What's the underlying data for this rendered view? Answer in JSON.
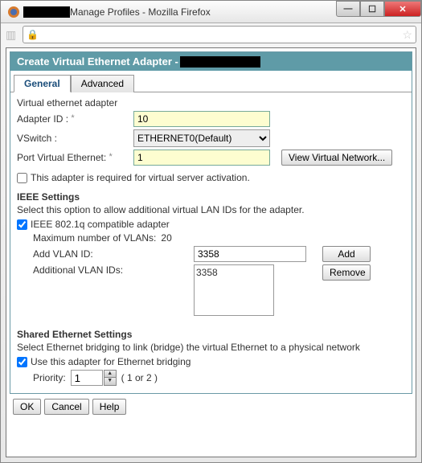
{
  "titlebar": {
    "text": "Manage Profiles - Mozilla Firefox"
  },
  "winbtns": {
    "min": "—",
    "max": "☐",
    "close": "✕"
  },
  "panel": {
    "title": "Create Virtual Ethernet Adapter - "
  },
  "tabs": {
    "general": "General",
    "advanced": "Advanced"
  },
  "form": {
    "section_label": "Virtual ethernet adapter",
    "adapter_id_label": "Adapter ID :",
    "adapter_id_value": "10",
    "vswitch_label": "VSwitch :",
    "vswitch_selected": "ETHERNET0(Default)",
    "pve_label": "Port Virtual Ethernet:",
    "pve_value": "1",
    "view_network_btn": "View Virtual Network...",
    "required_label": "This adapter is required for virtual server activation."
  },
  "ieee": {
    "title": "IEEE Settings",
    "desc": "Select this option to allow additional virtual LAN IDs for the adapter.",
    "compat_label": "IEEE 802.1q compatible adapter",
    "max_vlans_label": "Maximum number of VLANs:",
    "max_vlans_value": "20",
    "add_vlan_label": "Add VLAN ID:",
    "add_vlan_value": "3358",
    "add_btn": "Add",
    "additional_label": "Additional VLAN IDs:",
    "listbox_value": "3358",
    "remove_btn": "Remove"
  },
  "shared": {
    "title": "Shared Ethernet Settings",
    "desc": "Select Ethernet bridging to link (bridge) the virtual Ethernet to a physical network",
    "use_bridge_label": "Use this adapter for Ethernet bridging",
    "priority_label": "Priority:",
    "priority_value": "1",
    "priority_hint": "( 1 or 2 )"
  },
  "buttons": {
    "ok": "OK",
    "cancel": "Cancel",
    "help": "Help"
  }
}
